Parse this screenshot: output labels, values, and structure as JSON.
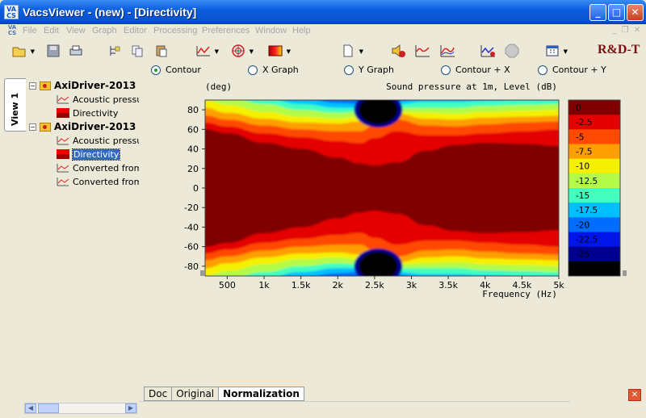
{
  "window": {
    "title": "VacsViewer - (new) - [Directivity]",
    "logo_text": "VA CS"
  },
  "menu": [
    "File",
    "Edit",
    "View",
    "Graph",
    "Editor",
    "Processing",
    "Preferences",
    "Window",
    "Help"
  ],
  "brand": "R&D-T",
  "view_modes": [
    {
      "label": "Contour",
      "selected": true
    },
    {
      "label": "X Graph",
      "selected": false
    },
    {
      "label": "Y Graph",
      "selected": false
    },
    {
      "label": "Contour + X",
      "selected": false
    },
    {
      "label": "Contour + Y",
      "selected": false
    }
  ],
  "side_tab": "View 1",
  "tree": [
    {
      "label": "AxiDriver-2013",
      "type": "folder"
    },
    {
      "label": "Acoustic pressure",
      "type": "curve"
    },
    {
      "label": "Directivity",
      "type": "map"
    },
    {
      "label": "AxiDriver-2013",
      "type": "folder"
    },
    {
      "label": "Acoustic pressure",
      "type": "curve"
    },
    {
      "label": "Directivity",
      "type": "map",
      "selected": true
    },
    {
      "label": "Converted from",
      "type": "curve"
    },
    {
      "label": "Converted from",
      "type": "curve"
    }
  ],
  "chart_data": {
    "type": "heatmap",
    "title": "Sound pressure at 1m, Level  (dB)",
    "ylabel": "(deg)",
    "xlabel": "Frequency  (Hz)",
    "xlim": [
      200,
      5000
    ],
    "ylim": [
      -90,
      90
    ],
    "x_ticks": [
      {
        "value": 500,
        "label": "500"
      },
      {
        "value": 1000,
        "label": "1k"
      },
      {
        "value": 1500,
        "label": "1.5k"
      },
      {
        "value": 2000,
        "label": "2k"
      },
      {
        "value": 2500,
        "label": "2.5k"
      },
      {
        "value": 3000,
        "label": "3k"
      },
      {
        "value": 3500,
        "label": "3.5k"
      },
      {
        "value": 4000,
        "label": "4k"
      },
      {
        "value": 4500,
        "label": "4.5k"
      },
      {
        "value": 5000,
        "label": "5k"
      }
    ],
    "y_ticks": [
      80,
      60,
      40,
      20,
      0,
      -20,
      -40,
      -60,
      -80
    ],
    "levels": [
      {
        "value": 0,
        "label": "0",
        "color": "#800000"
      },
      {
        "value": -2.5,
        "label": "-2.5",
        "color": "#e40000"
      },
      {
        "value": -5,
        "label": "-5",
        "color": "#ff4a00"
      },
      {
        "value": -7.5,
        "label": "-7.5",
        "color": "#ff9e00"
      },
      {
        "value": -10,
        "label": "-10",
        "color": "#f4f000"
      },
      {
        "value": -12.5,
        "label": "-12.5",
        "color": "#b2fb48"
      },
      {
        "value": -15,
        "label": "-15",
        "color": "#40ffbf"
      },
      {
        "value": -17.5,
        "label": "-17.5",
        "color": "#00bfff"
      },
      {
        "value": -20,
        "label": "-20",
        "color": "#006dff"
      },
      {
        "value": -22.5,
        "label": "-22.5",
        "color": "#0016e8"
      },
      {
        "value": -25,
        "label": "-25",
        "color": "#000090"
      },
      {
        "value": -27.5,
        "label": "",
        "color": "#000000"
      }
    ],
    "nulls": [
      {
        "freq": 2550,
        "angle": 80
      },
      {
        "freq": 2550,
        "angle": -80
      }
    ],
    "beam_edges": [
      {
        "level": -2.5,
        "angles": [
          [
            200,
            60
          ],
          [
            500,
            56
          ],
          [
            1000,
            46
          ],
          [
            1500,
            40
          ],
          [
            2000,
            31
          ],
          [
            2300,
            25
          ],
          [
            2500,
            23
          ],
          [
            2800,
            26
          ],
          [
            3200,
            38
          ],
          [
            3600,
            44
          ],
          [
            4000,
            46
          ],
          [
            4500,
            45
          ],
          [
            5000,
            43
          ]
        ]
      },
      {
        "level": -5,
        "angles": [
          [
            200,
            67
          ],
          [
            500,
            63
          ],
          [
            1000,
            56
          ],
          [
            1500,
            52
          ],
          [
            2000,
            48
          ],
          [
            2300,
            46
          ],
          [
            2500,
            51
          ],
          [
            2800,
            58
          ],
          [
            3200,
            54
          ],
          [
            3600,
            54
          ],
          [
            4000,
            56
          ],
          [
            4500,
            58
          ],
          [
            5000,
            60
          ]
        ]
      },
      {
        "level": -7.5,
        "angles": [
          [
            200,
            74
          ],
          [
            500,
            70
          ],
          [
            1000,
            64
          ],
          [
            1500,
            60
          ],
          [
            2000,
            58
          ],
          [
            2300,
            58
          ],
          [
            2500,
            64
          ],
          [
            2800,
            70
          ],
          [
            3200,
            64
          ],
          [
            3600,
            63
          ],
          [
            4000,
            65
          ],
          [
            4500,
            67
          ],
          [
            5000,
            68
          ]
        ]
      },
      {
        "level": -10,
        "angles": [
          [
            200,
            82
          ],
          [
            500,
            77
          ],
          [
            1000,
            71
          ],
          [
            1500,
            67
          ],
          [
            2000,
            66
          ],
          [
            2300,
            68
          ],
          [
            2500,
            72
          ],
          [
            2800,
            76
          ],
          [
            3200,
            71
          ],
          [
            3600,
            70
          ],
          [
            4000,
            72
          ],
          [
            4500,
            73
          ],
          [
            5000,
            74
          ]
        ]
      },
      {
        "level": -12.5,
        "angles": [
          [
            200,
            90
          ],
          [
            500,
            85
          ],
          [
            1000,
            78
          ],
          [
            1500,
            73
          ],
          [
            2000,
            71
          ],
          [
            2300,
            73
          ],
          [
            2500,
            76
          ],
          [
            2800,
            78
          ],
          [
            3200,
            77
          ],
          [
            3600,
            76
          ],
          [
            4000,
            78
          ],
          [
            4500,
            79
          ],
          [
            5000,
            80
          ]
        ]
      },
      {
        "level": -15,
        "angles": [
          [
            200,
            95
          ],
          [
            500,
            93
          ],
          [
            1000,
            86
          ],
          [
            1500,
            80
          ],
          [
            2000,
            77
          ],
          [
            2300,
            78
          ],
          [
            2500,
            80
          ],
          [
            2800,
            82
          ],
          [
            3200,
            82
          ],
          [
            3600,
            82
          ],
          [
            4000,
            84
          ],
          [
            4500,
            85
          ],
          [
            5000,
            86
          ]
        ]
      },
      {
        "level": -17.5,
        "angles": [
          [
            200,
            96
          ],
          [
            500,
            96
          ],
          [
            1000,
            92
          ],
          [
            1500,
            86
          ],
          [
            2000,
            82
          ],
          [
            2300,
            82
          ],
          [
            2500,
            84
          ],
          [
            2800,
            86
          ],
          [
            3200,
            88
          ],
          [
            3600,
            88
          ],
          [
            4000,
            89
          ],
          [
            4500,
            90
          ],
          [
            5000,
            90
          ]
        ]
      },
      {
        "level": -20,
        "angles": [
          [
            200,
            98
          ],
          [
            500,
            98
          ],
          [
            1000,
            97
          ],
          [
            1500,
            92
          ],
          [
            2000,
            87
          ],
          [
            2300,
            86
          ],
          [
            2500,
            87
          ],
          [
            2800,
            89
          ],
          [
            3200,
            93
          ],
          [
            3600,
            94
          ],
          [
            4000,
            95
          ],
          [
            4500,
            96
          ],
          [
            5000,
            96
          ]
        ]
      }
    ]
  },
  "bottom_tabs": [
    {
      "label": "Doc",
      "active": false
    },
    {
      "label": "Original",
      "active": false
    },
    {
      "label": "Normalization",
      "active": true
    }
  ]
}
